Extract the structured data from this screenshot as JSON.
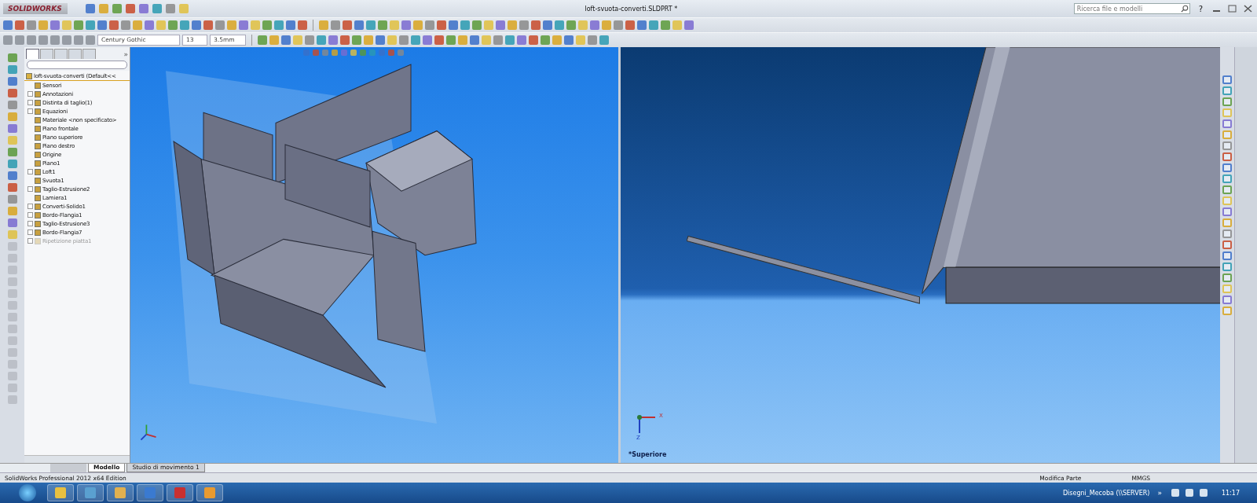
{
  "app": {
    "logo": "SOLIDWORKS",
    "title": "loft-svuota-converti.SLDPRT *",
    "search": {
      "placeholder": "Ricerca file e modelli"
    },
    "help": "?"
  },
  "format_toolbar": {
    "font": "Century Gothic",
    "size": "13",
    "height": "3.5mm"
  },
  "feature_manager": {
    "panel_tabs": [
      {
        "selected": true
      },
      {
        "selected": false
      },
      {
        "selected": false
      },
      {
        "selected": false
      },
      {
        "selected": false
      }
    ],
    "collapse": "»",
    "root": "loft-svuota-converti  (Default<<",
    "items": [
      {
        "label": "Sensori",
        "has_children": false,
        "disabled": false
      },
      {
        "label": "Annotazioni",
        "has_children": true,
        "disabled": false
      },
      {
        "label": "Distinta di taglio(1)",
        "has_children": true,
        "disabled": false
      },
      {
        "label": "Equazioni",
        "has_children": true,
        "disabled": false
      },
      {
        "label": "Materiale <non specificato>",
        "has_children": false,
        "disabled": false
      },
      {
        "label": "Piano frontale",
        "has_children": false,
        "disabled": false
      },
      {
        "label": "Piano superiore",
        "has_children": false,
        "disabled": false
      },
      {
        "label": "Piano destro",
        "has_children": false,
        "disabled": false
      },
      {
        "label": "Origine",
        "has_children": false,
        "disabled": false
      },
      {
        "label": "Piano1",
        "has_children": false,
        "disabled": false
      },
      {
        "label": "Loft1",
        "has_children": true,
        "disabled": false
      },
      {
        "label": "Svuota1",
        "has_children": false,
        "disabled": false
      },
      {
        "label": "Taglio-Estrusione2",
        "has_children": true,
        "disabled": false
      },
      {
        "label": "Lamiera1",
        "has_children": false,
        "disabled": false
      },
      {
        "label": "Converti-Solido1",
        "has_children": true,
        "disabled": false
      },
      {
        "label": "Bordo-Flangia1",
        "has_children": true,
        "disabled": false
      },
      {
        "label": "Taglio-Estrusione3",
        "has_children": true,
        "disabled": false
      },
      {
        "label": "Bordo-Flangia7",
        "has_children": true,
        "disabled": false
      },
      {
        "label": "Ripetizione piatta1",
        "has_children": true,
        "disabled": true
      }
    ]
  },
  "right_view": {
    "axis_x": "X",
    "axis_z": "Z",
    "view_name": "*Superiore"
  },
  "model_tabs": [
    {
      "label": "Modello",
      "selected": true
    },
    {
      "label": "Studio di movimento 1",
      "selected": false
    }
  ],
  "status_bar": {
    "edition": "SolidWorks Professional 2012 x64 Edition",
    "mode": "Modifica Parte",
    "units": "MMGS"
  },
  "taskbar": {
    "location": "Disegni_Mecoba (\\\\SERVER)",
    "overflow": "»",
    "time": "11:17"
  }
}
